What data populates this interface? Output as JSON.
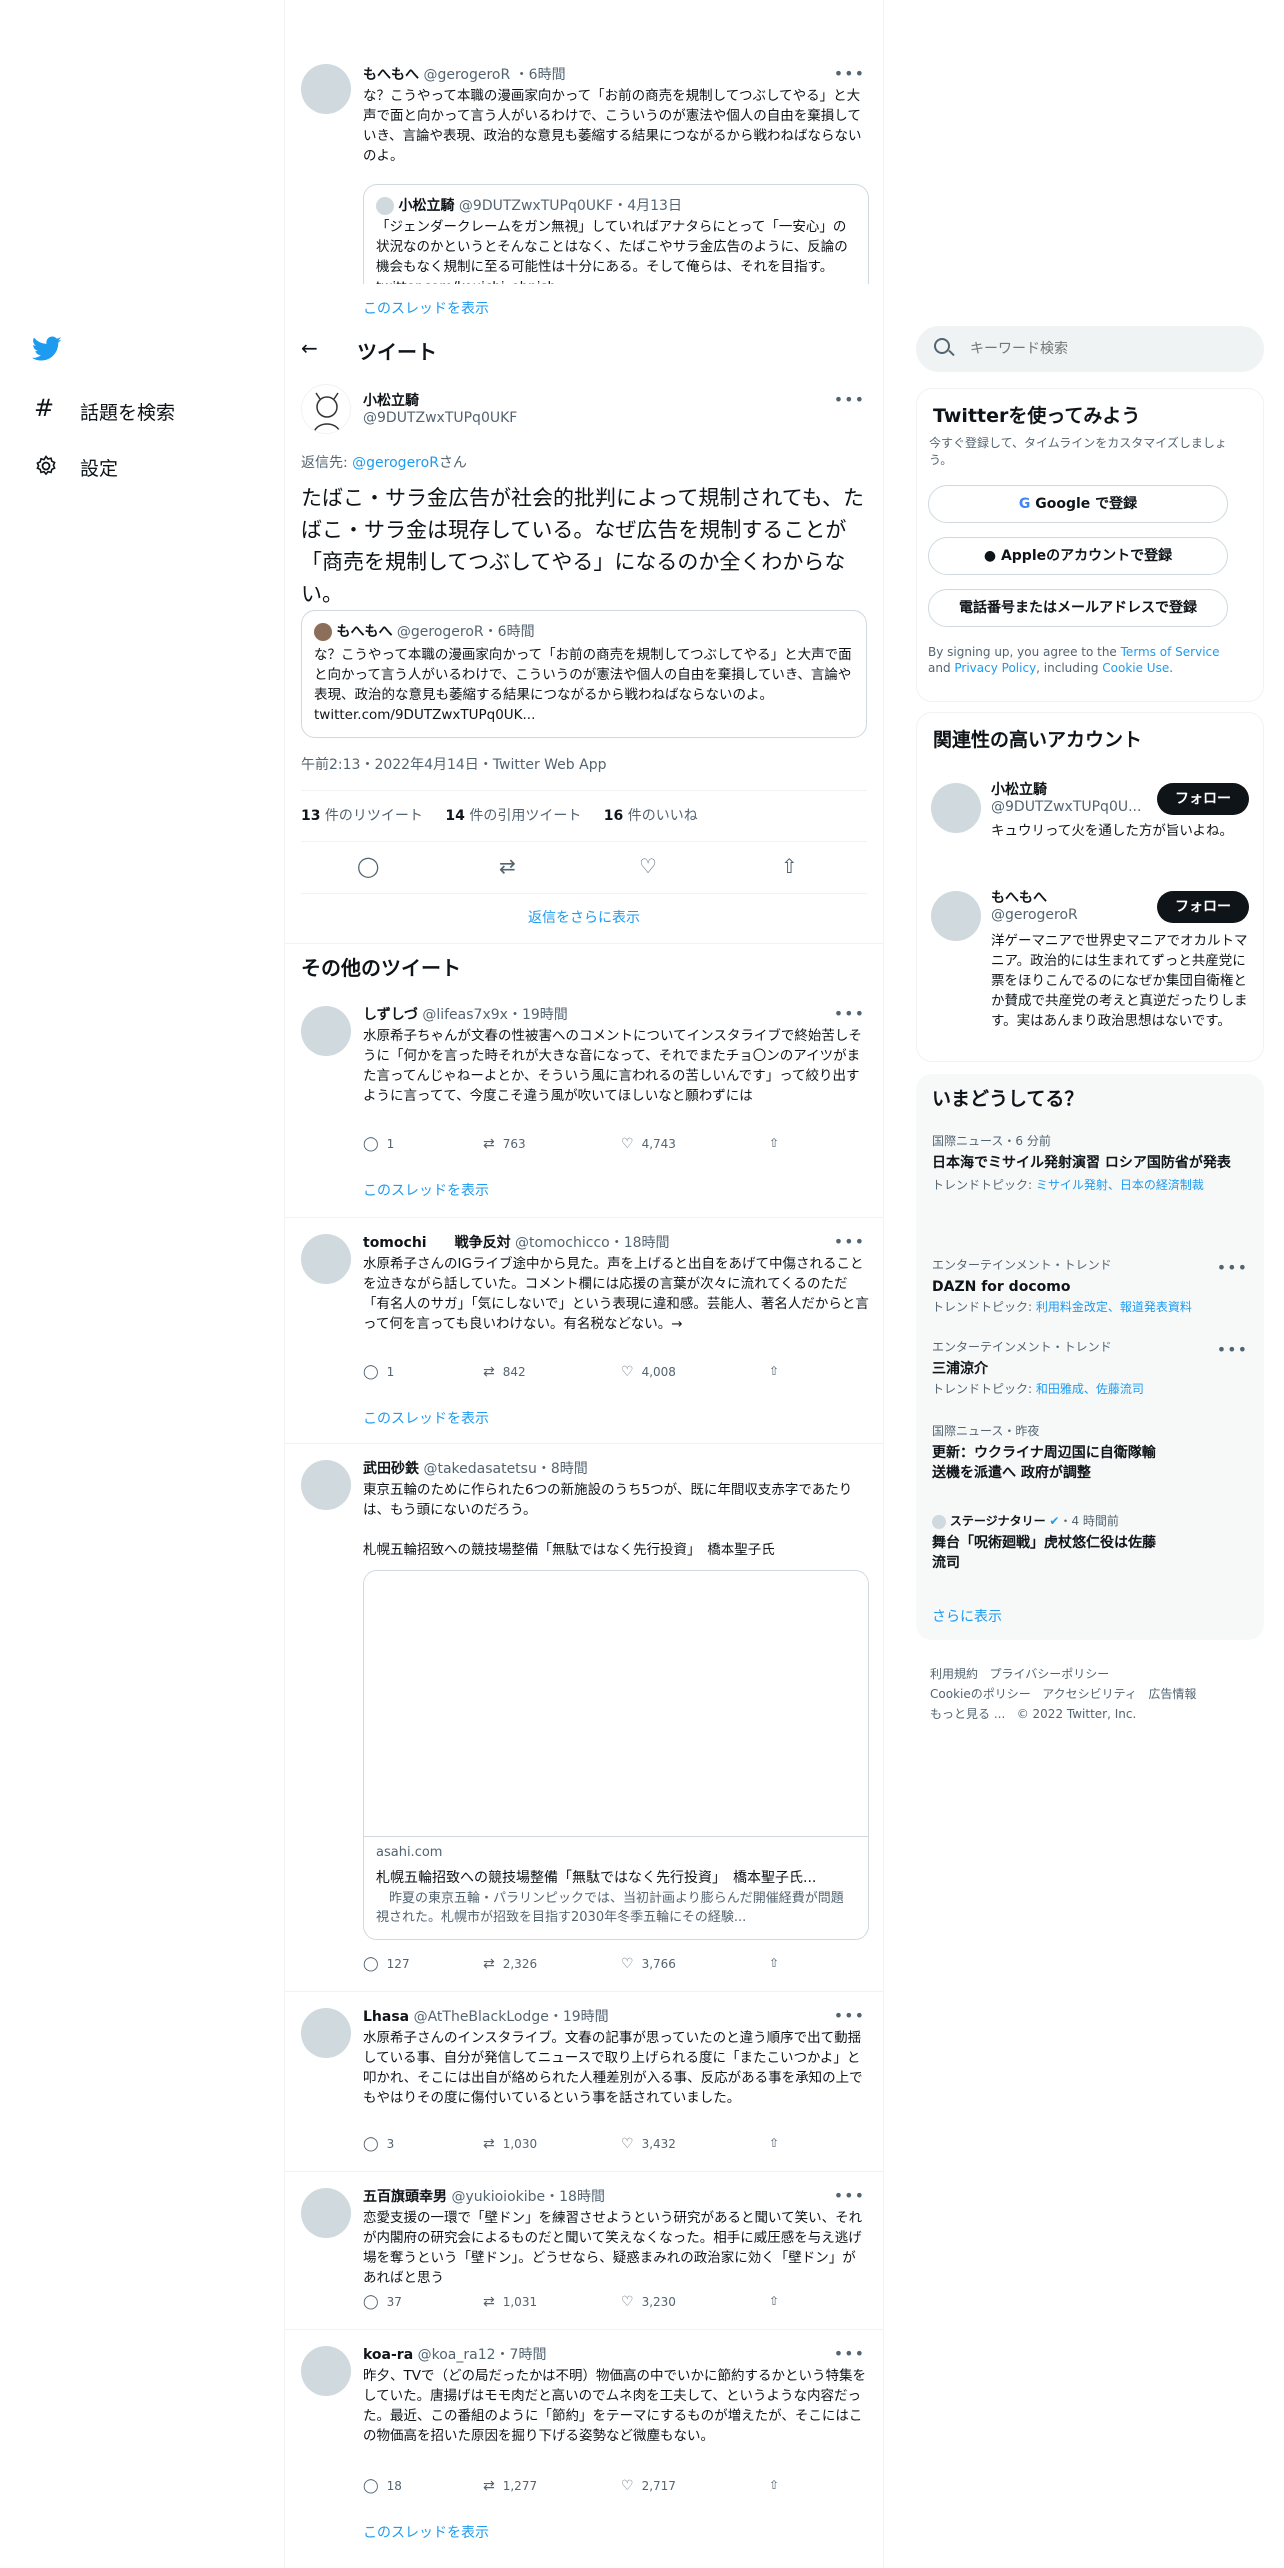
{
  "nav": {
    "explore": "話題を検索",
    "settings": "設定"
  },
  "header": {
    "back": "←",
    "title": "ツイート"
  },
  "top_tweet": {
    "name": "もへもへ",
    "handle": "@gerogeroR",
    "time": "6時間",
    "text": "な？こうやって本職の漫画家向かって「お前の商売を規制してつぶしてやる」と大声で面と向かって言う人がいるわけで、こういうのが憲法や個人の自由を棄損していき、言論や表現、政治的な意見も萎縮する結果につながるから戦わねばならないのよ。",
    "quote": {
      "name": "小松立騎",
      "handle": "@9DUTZwxTUPq0UKF",
      "time": "4月13日",
      "text": "「ジェンダークレームをガン無視」していればアナタらにとって「一安心」の状況なのかというとそんなことはなく、たばこやサラ金広告のように、反論の機会もなく規制に至る可能性は十分にある。そして俺らは、それを目指す。 twitter.com/kouichi_ohnish..."
    },
    "thread_link": "このスレッドを表示"
  },
  "main_tweet": {
    "name": "小松立騎",
    "handle": "@9DUTZwxTUPq0UKF",
    "reply_prefix": "返信先: ",
    "reply_to": "@gerogeroR",
    "reply_suffix": "さん",
    "text": "たばこ・サラ金広告が社会的批判によって規制されても、たばこ・サラ金は現存している。なぜ広告を規制することが「商売を規制してつぶしてやる」になるのか全くわからない。",
    "quote": {
      "name": "もへもへ",
      "handle": "@gerogeroR",
      "time": "6時間",
      "text": "な？こうやって本職の漫画家向かって「お前の商売を規制してつぶしてやる」と大声で面と向かって言う人がいるわけで、こういうのが憲法や個人の自由を棄損していき、言論や表現、政治的な意見も萎縮する結果につながるから戦わねばならないのよ。 twitter.com/9DUTZwxTUPq0UK..."
    },
    "timestamp": "午前2:13・2022年4月14日・Twitter Web App",
    "retweets": "13",
    "retweets_label": " 件のリツイート",
    "quotes": "14",
    "quotes_label": " 件の引用ツイート",
    "likes": "16",
    "likes_label": " 件のいいね",
    "show_more_replies": "返信をさらに表示"
  },
  "other_tweets_heading": "その他のツイート",
  "tweets": [
    {
      "name": "しずしづ",
      "handle": "@lifeas7x9x",
      "time": "19時間",
      "text": "水原希子ちゃんが文春の性被害へのコメントについてインスタライブで終始苦しそうに「何かを言った時それが大きな音になって、それでまたチョ〇ンのアイツがまた言ってんじゃねーよとか、そういう風に言われるの苦しいんです」って絞り出すように言ってて、今度こそ違う風が吹いてほしいなと願わずには",
      "replies": "1",
      "retweets": "763",
      "likes": "4,743",
      "thread": "このスレッドを表示"
    },
    {
      "name": "tomochi　　戦争反対",
      "handle": "@tomochicco",
      "time": "18時間",
      "text": "水原希子さんのIGライブ途中から見た。声を上げると出自をあげて中傷されることを泣きながら話していた。コメント欄には応援の言葉が次々に流れてくるのただ「有名人のサガ」「気にしないで」という表現に違和感。芸能人、著名人だからと言って何を言っても良いわけない。有名税などない。→",
      "replies": "1",
      "retweets": "842",
      "likes": "4,008",
      "thread": "このスレッドを表示"
    },
    {
      "name": "武田砂鉄",
      "handle": "@takedasatetsu",
      "time": "8時間",
      "text": "東京五輪のために作られた6つの新施設のうち5つが、既に年間収支赤字であたりは、もう頭にないのだろう。\n\n札幌五輪招致への競技場整備「無駄ではなく先行投資」　橋本聖子氏",
      "card": {
        "domain": "asahi.com",
        "title": "札幌五輪招致への競技場整備「無駄ではなく先行投資」　橋本聖子氏...",
        "desc": "　昨夏の東京五輪・パラリンピックでは、当初計画より膨らんだ開催経費が問題視された。札幌市が招致を目指す2030年冬季五輪にその経験..."
      },
      "replies": "127",
      "retweets": "2,326",
      "likes": "3,766"
    },
    {
      "name": "Lhasa",
      "handle": "@AtTheBlackLodge",
      "time": "19時間",
      "text": "水原希子さんのインスタライブ。文春の記事が思っていたのと違う順序で出て動揺している事、自分が発信してニュースで取り上げられる度に「またこいつかよ」と叩かれ、そこには出自が絡められた人種差別が入る事、反応がある事を承知の上でもやはりその度に傷付いているという事を話されていました。",
      "replies": "3",
      "retweets": "1,030",
      "likes": "3,432"
    },
    {
      "name": "五百旗頭幸男",
      "handle": "@yukioiokibe",
      "time": "18時間",
      "text": "恋愛支援の一環で「壁ドン」を練習させようという研究があると聞いて笑い、それが内閣府の研究会によるものだと聞いて笑えなくなった。相手に威圧感を与え逃げ場を奪うという「壁ドン」。どうせなら、疑惑まみれの政治家に効く「壁ドン」があればと思う",
      "replies": "37",
      "retweets": "1,031",
      "likes": "3,230"
    },
    {
      "name": "koa-ra",
      "handle": "@koa_ra12",
      "time": "7時間",
      "text": "昨夕、TVで（どの局だったかは不明）物価高の中でいかに節約するかという特集をしていた。唐揚げはモモ肉だと高いのでムネ肉を工夫して、というような内容だった。最近、この番組のように「節約」をテーマにするものが増えたが、そこにはこの物価高を招いた原因を掘り下げる姿勢など微塵もない。",
      "replies": "18",
      "retweets": "1,277",
      "likes": "2,717",
      "thread": "このスレッドを表示"
    }
  ],
  "search": {
    "placeholder": "キーワード検索"
  },
  "signup": {
    "title": "Twitterを使ってみよう",
    "subtitle": "今すぐ登録して、タイムラインをカスタマイズしましょう。",
    "google": "Google で登録",
    "apple": "Appleのアカウントで登録",
    "phone": "電話番号またはメールアドレスで登録",
    "terms_pre": "By signing up, you agree to the ",
    "terms_tos": "Terms of Service",
    "terms_and": " and ",
    "terms_privacy": "Privacy Policy",
    "terms_incl": ", including ",
    "terms_cookie": "Cookie Use",
    "terms_end": "."
  },
  "relevant": {
    "title": "関連性の高いアカウント",
    "accounts": [
      {
        "name": "小松立騎",
        "handle": "@9DUTZwxTUPq0U...",
        "bio": "キュウリって火を通した方が旨いよね。",
        "follow": "フォロー"
      },
      {
        "name": "もへもへ",
        "handle": "@gerogeroR",
        "bio": "洋ゲーマニアで世界史マニアでオカルトマニア。政治的には生まれてずっと共産党に票をほりこんでるのになぜか集団自衛権とか賛成で共産党の考えと真逆だったりします。実はあんまり政治思想はないです。",
        "follow": "フォロー"
      }
    ]
  },
  "trends": {
    "title": "いまどうしてる？",
    "items": [
      {
        "meta": "国際ニュース・6 分前",
        "title": "日本海でミサイル発射演習 ロシア国防省が発表",
        "sub_label": "トレンドトピック: ",
        "sub": "ミサイル発射、日本の経済制裁"
      },
      {
        "meta": "エンターテインメント・トレンド",
        "title": "DAZN for docomo",
        "sub_label": "トレンドトピック: ",
        "sub": "利用料金改定、報道発表資料"
      },
      {
        "meta": "エンターテインメント・トレンド",
        "title": "三浦涼介",
        "sub_label": "トレンドトピック: ",
        "sub": "和田雅成、佐藤流司"
      },
      {
        "meta": "国際ニュース・昨夜",
        "title": "更新：ウクライナ周辺国に自衛隊輸送機を派遣へ 政府が調整",
        "sub_label": "",
        "sub": ""
      },
      {
        "meta": "ステージナタリー",
        "meta_time": "・4 時間前",
        "title": "舞台「呪術廻戦」虎杖悠仁役は佐藤流司",
        "sub_label": "",
        "sub": ""
      }
    ],
    "more": "さらに表示"
  },
  "footer": {
    "terms": "利用規約",
    "privacy": "プライバシーポリシー",
    "cookie": "Cookieのポリシー",
    "accessibility": "アクセシビリティ",
    "ads": "広告情報",
    "more": "もっと見る ...",
    "copyright": "© 2022 Twitter, Inc."
  },
  "colors": {
    "accent": "#1d9bf0",
    "text": "#0f1419",
    "muted": "#536471",
    "border": "#eff3f4",
    "trend_bg": "#f7f9f9"
  }
}
